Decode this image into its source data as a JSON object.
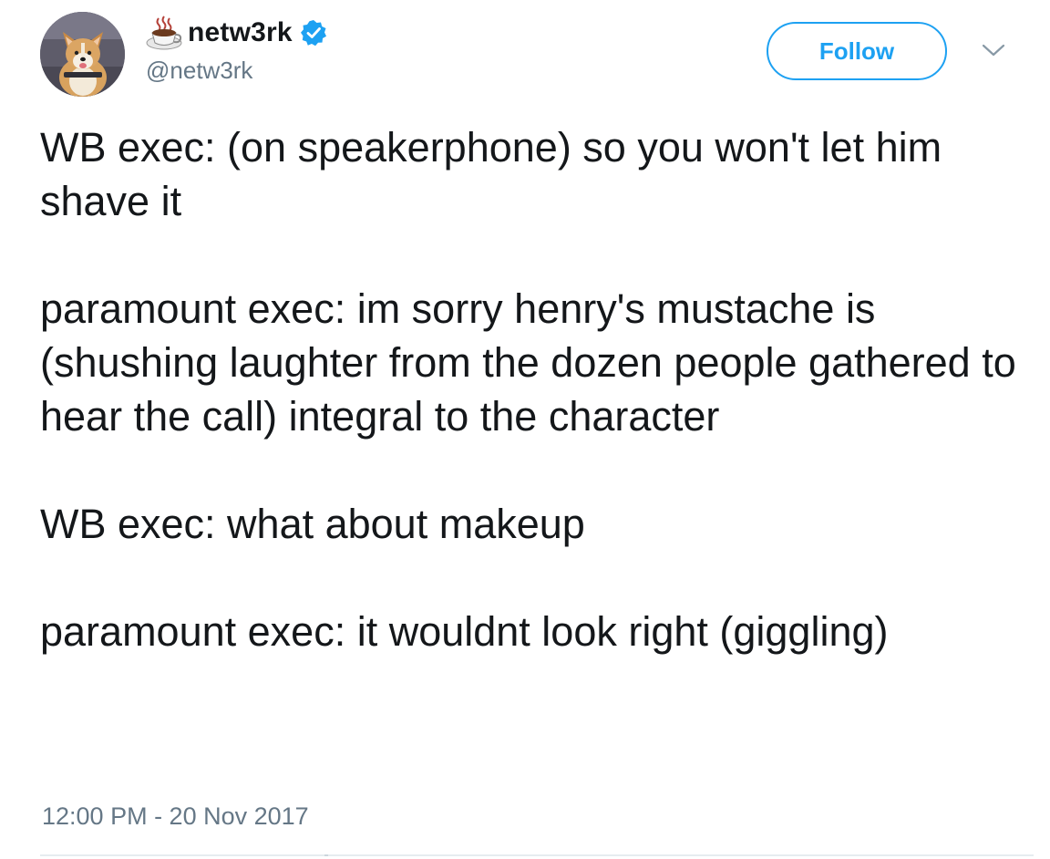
{
  "user": {
    "display_name": "netw3rk",
    "handle": "@netw3rk",
    "verified": true,
    "avatar_icon": "corgi-avatar",
    "name_emoji_icon": "hot-beverage-cup-icon"
  },
  "actions": {
    "follow_label": "Follow",
    "more_icon": "chevron-down-icon"
  },
  "tweet": {
    "paragraphs": [
      "WB exec: (on speakerphone) so you won't let him shave it",
      "paramount exec: im sorry henry's mustache is (shushing laughter from the dozen people gathered to hear the call) integral to the character",
      "WB exec: what about makeup",
      "paramount exec: it wouldnt look right (giggling)"
    ],
    "timestamp": "12:00 PM - 20 Nov 2017"
  },
  "colors": {
    "accent": "#1da1f2",
    "text": "#14171a",
    "secondary_text": "#657786"
  }
}
